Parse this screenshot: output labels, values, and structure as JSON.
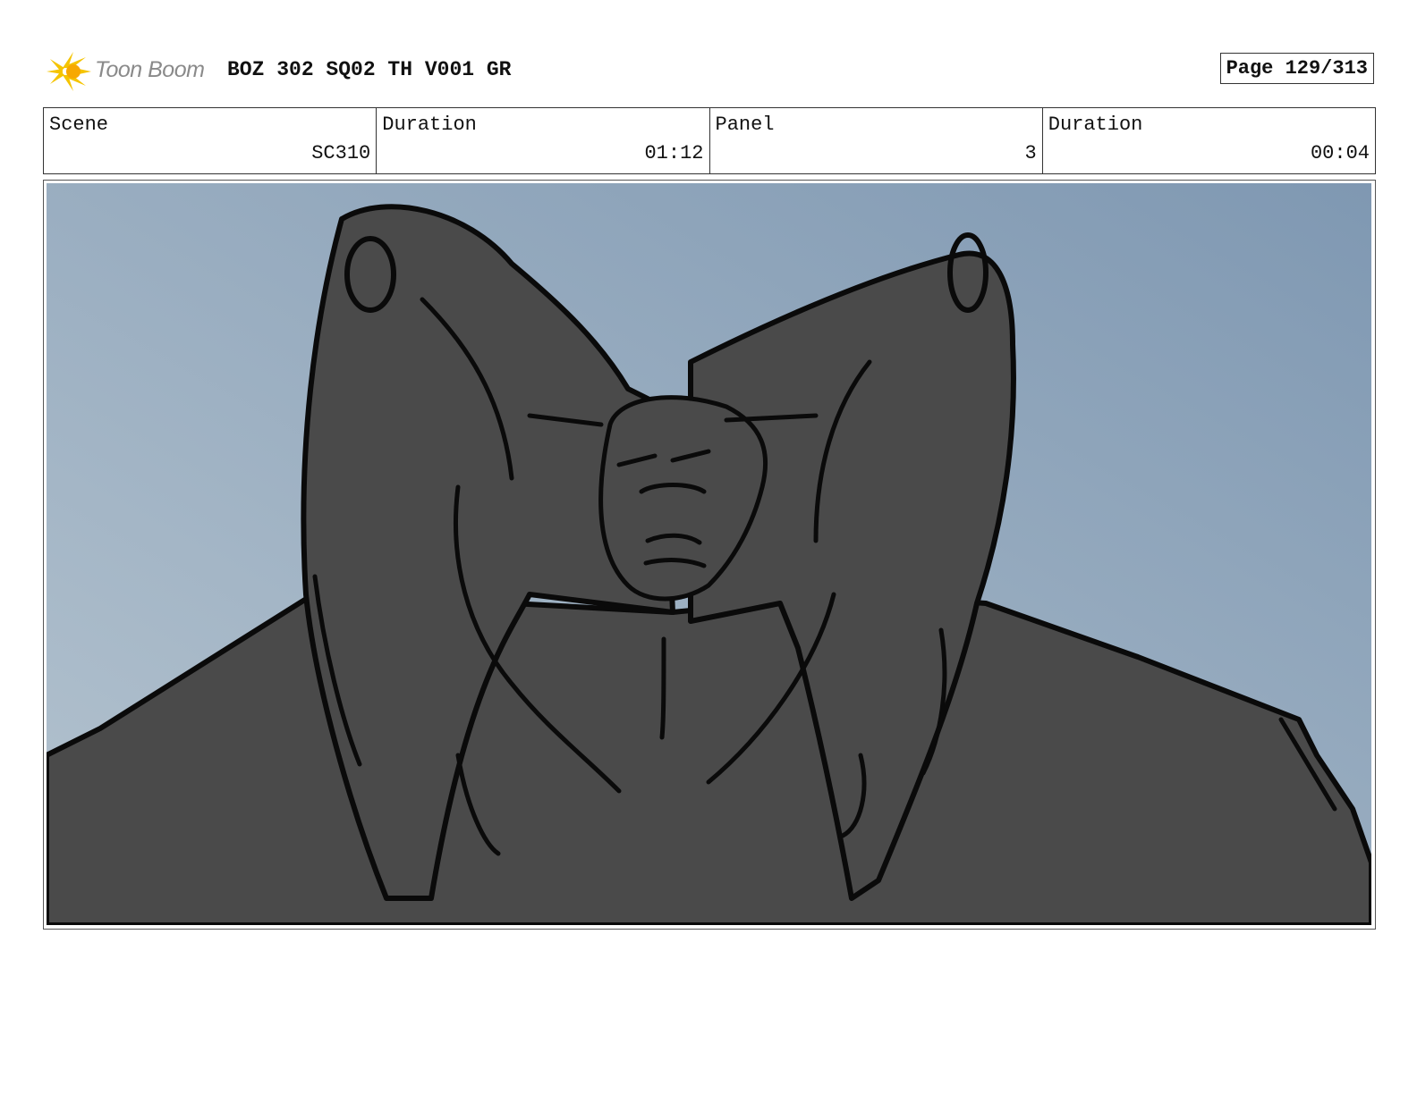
{
  "header": {
    "logo_text": "Toon Boom",
    "title": "BOZ 302 SQ02 TH V001 GR",
    "page": "Page 129/313"
  },
  "info": {
    "scene_label": "Scene",
    "scene_value": "SC310",
    "scene_duration_label": "Duration",
    "scene_duration_value": "01:12",
    "panel_label": "Panel",
    "panel_value": "3",
    "panel_duration_label": "Duration",
    "panel_duration_value": "00:04"
  },
  "colors": {
    "sky_light": "#b4c3cf",
    "sky_dark": "#7f98b2",
    "figure": "#4a4a4a",
    "ink": "#0a0a0a",
    "logo_yellow": "#f5c400"
  }
}
